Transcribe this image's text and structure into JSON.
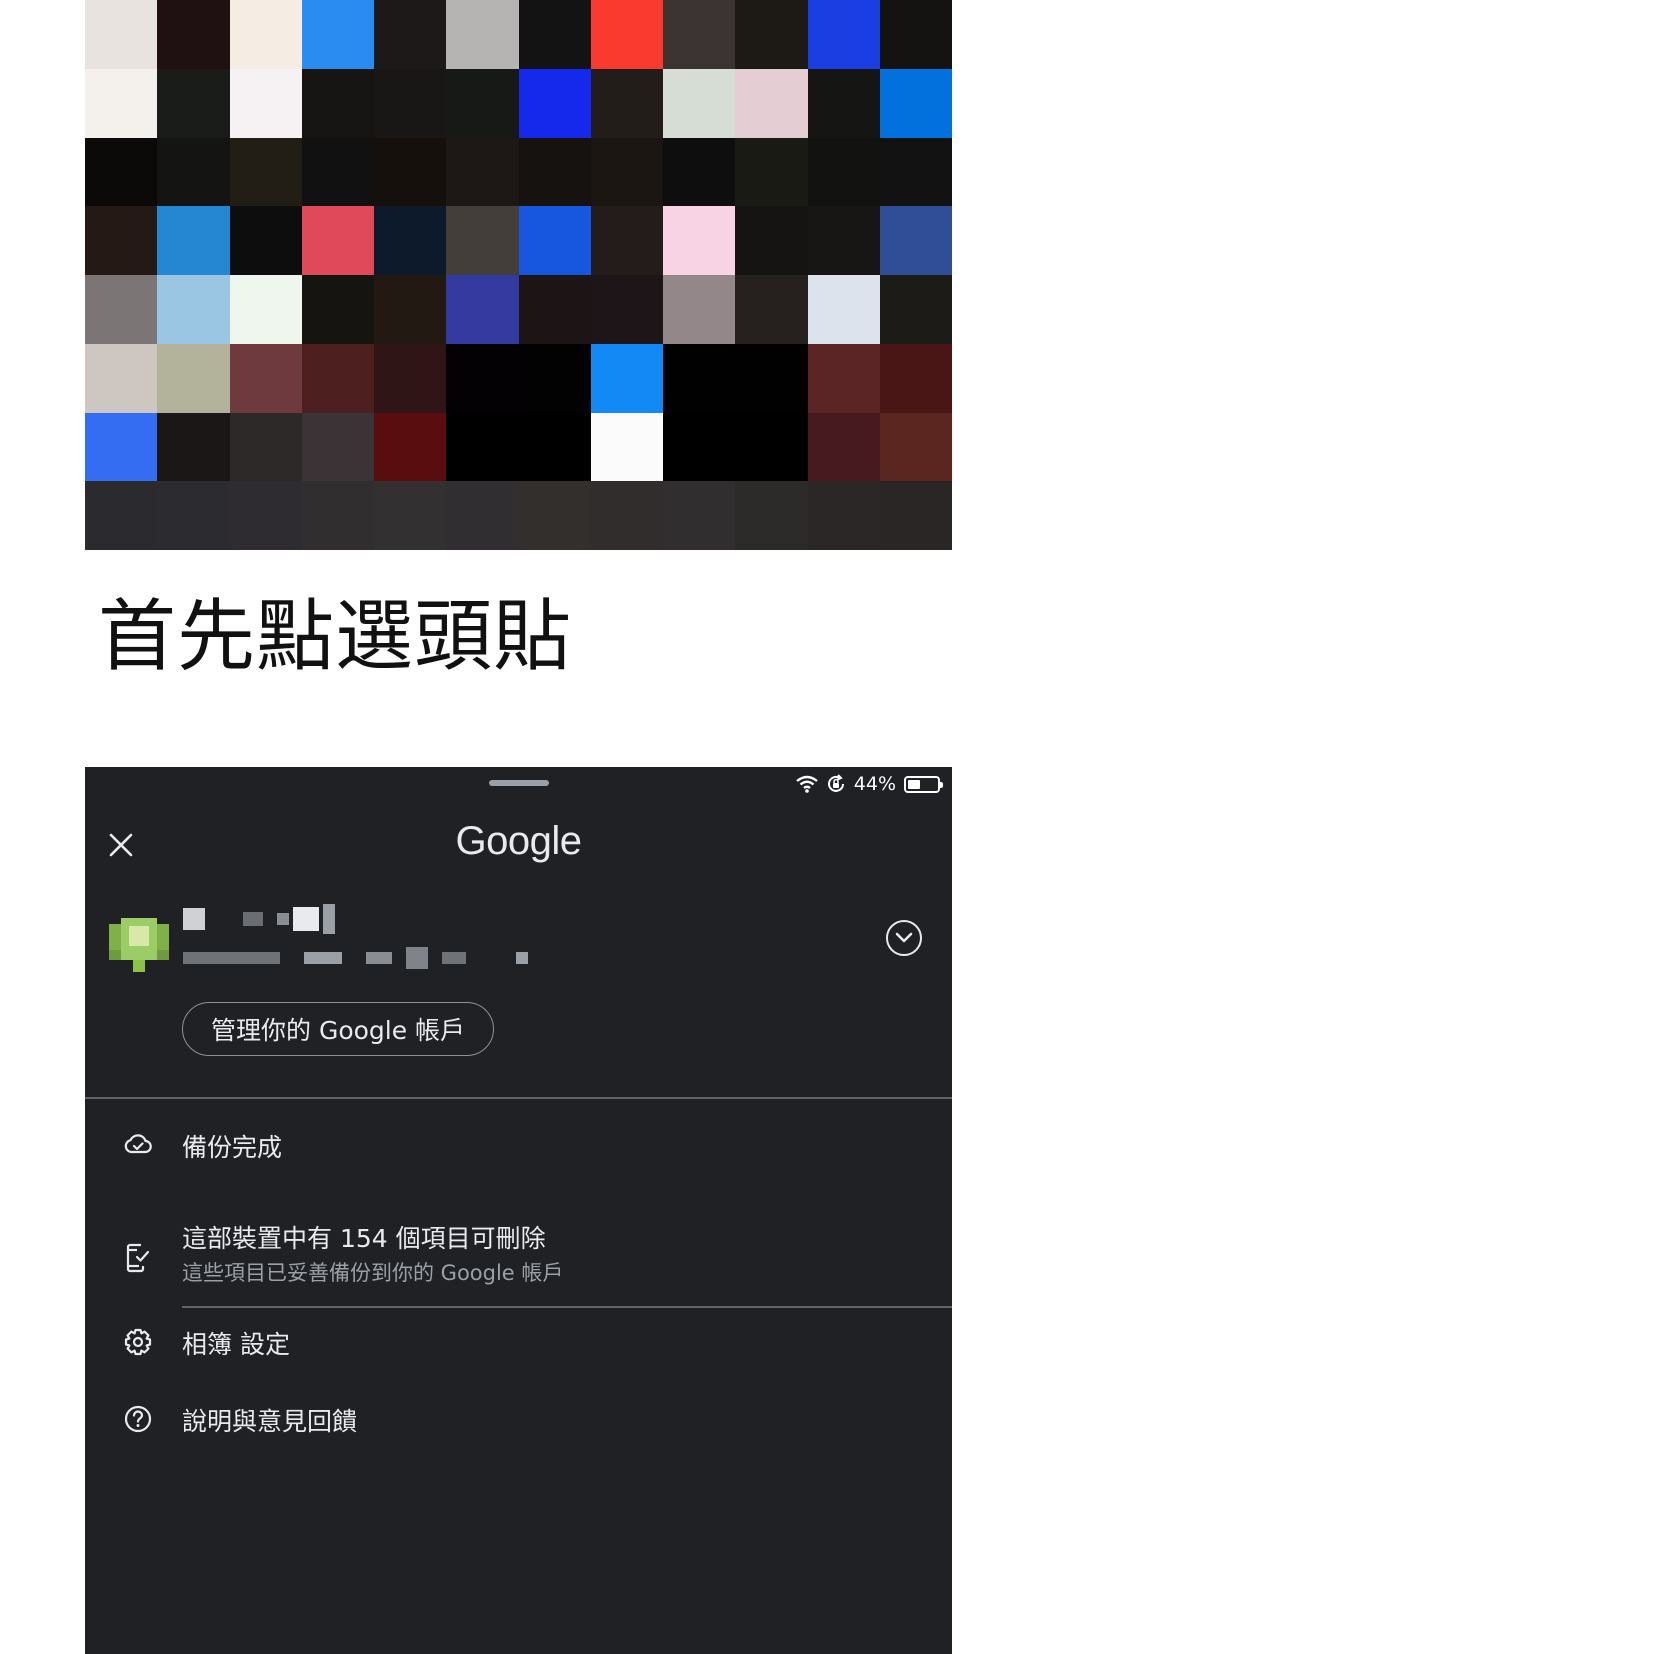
{
  "instruction_text": "首先點選頭貼",
  "thumbnail": {
    "pixels": [
      [
        "#e9e3df",
        "#1f1111",
        "#f5ece4",
        "#2a8cf0",
        "#1c1918",
        "#b5b4b2",
        "#131313",
        "#fb3a2f",
        "#3c3432",
        "#1d1a15",
        "#1a3ee2",
        "#141312"
      ],
      [
        "#f4f1ec",
        "#1a1c1a",
        "#f6f1f2",
        "#161513",
        "#181716",
        "#171916",
        "#1429ec",
        "#221d19",
        "#d6ddd5",
        "#e4ced4",
        "#151514",
        "#0371dd"
      ],
      [
        "#0b0a09",
        "#141413",
        "#221e16",
        "#111111",
        "#15100c",
        "#1d1815",
        "#16120f",
        "#1b1611",
        "#0f0e0e",
        "#1a1a14",
        "#121211",
        "#111211"
      ],
      [
        "#241915",
        "#2587d2",
        "#0e0d0d",
        "#e0495a",
        "#0d1a2b",
        "#443e3b",
        "#1757e0",
        "#231c1a",
        "#f8d3e4",
        "#151412",
        "#171615",
        "#2f4e97"
      ],
      [
        "#7b7576",
        "#9ac6e4",
        "#eff6ed",
        "#151411",
        "#221a12",
        "#353aa0",
        "#1c1415",
        "#1d1517",
        "#938789",
        "#26211e",
        "#dde3ed",
        "#1c1b18"
      ],
      [
        "#cec6c0",
        "#b3b39b",
        "#6e3a3e",
        "#4e1f1f",
        "#301517",
        "#030103",
        "#020202",
        "#1289f4",
        "#010101",
        "#020102",
        "#5a2524",
        "#4a1615"
      ],
      [
        "#356df2",
        "#1b1716",
        "#2d2929",
        "#3c3337",
        "#5a0d0f",
        "#010000",
        "#000000",
        "#fbfbfb",
        "#000000",
        "#000000",
        "#461a1f",
        "#5b2520"
      ],
      [
        "#2b2a2e",
        "#2c2b2f",
        "#2e2c30",
        "#312e30",
        "#333031",
        "#302e30",
        "#322f2d",
        "#312d2c",
        "#302e2e",
        "#2d2b2a",
        "#2b2727",
        "#2a2625"
      ]
    ]
  },
  "status_bar": {
    "battery_text": "44%",
    "battery_level": 0.44
  },
  "header": {
    "logo_text": "Google"
  },
  "account": {
    "manage_button_label": "管理你的 Google 帳戶"
  },
  "menu": {
    "backup": {
      "label": "備份完成"
    },
    "free_space": {
      "label": "這部裝置中有 154 個項目可刪除",
      "sublabel": "這些項目已妥善備份到你的 Google 帳戶"
    },
    "settings": {
      "label": "相簿 設定"
    },
    "help": {
      "label": "說明與意見回饋"
    }
  },
  "colors": {
    "panel_bg": "#202124",
    "text_primary": "#e8eaed",
    "text_secondary": "#9aa0a6",
    "divider": "#5f6368",
    "avatar_green": "#8bc34a"
  }
}
